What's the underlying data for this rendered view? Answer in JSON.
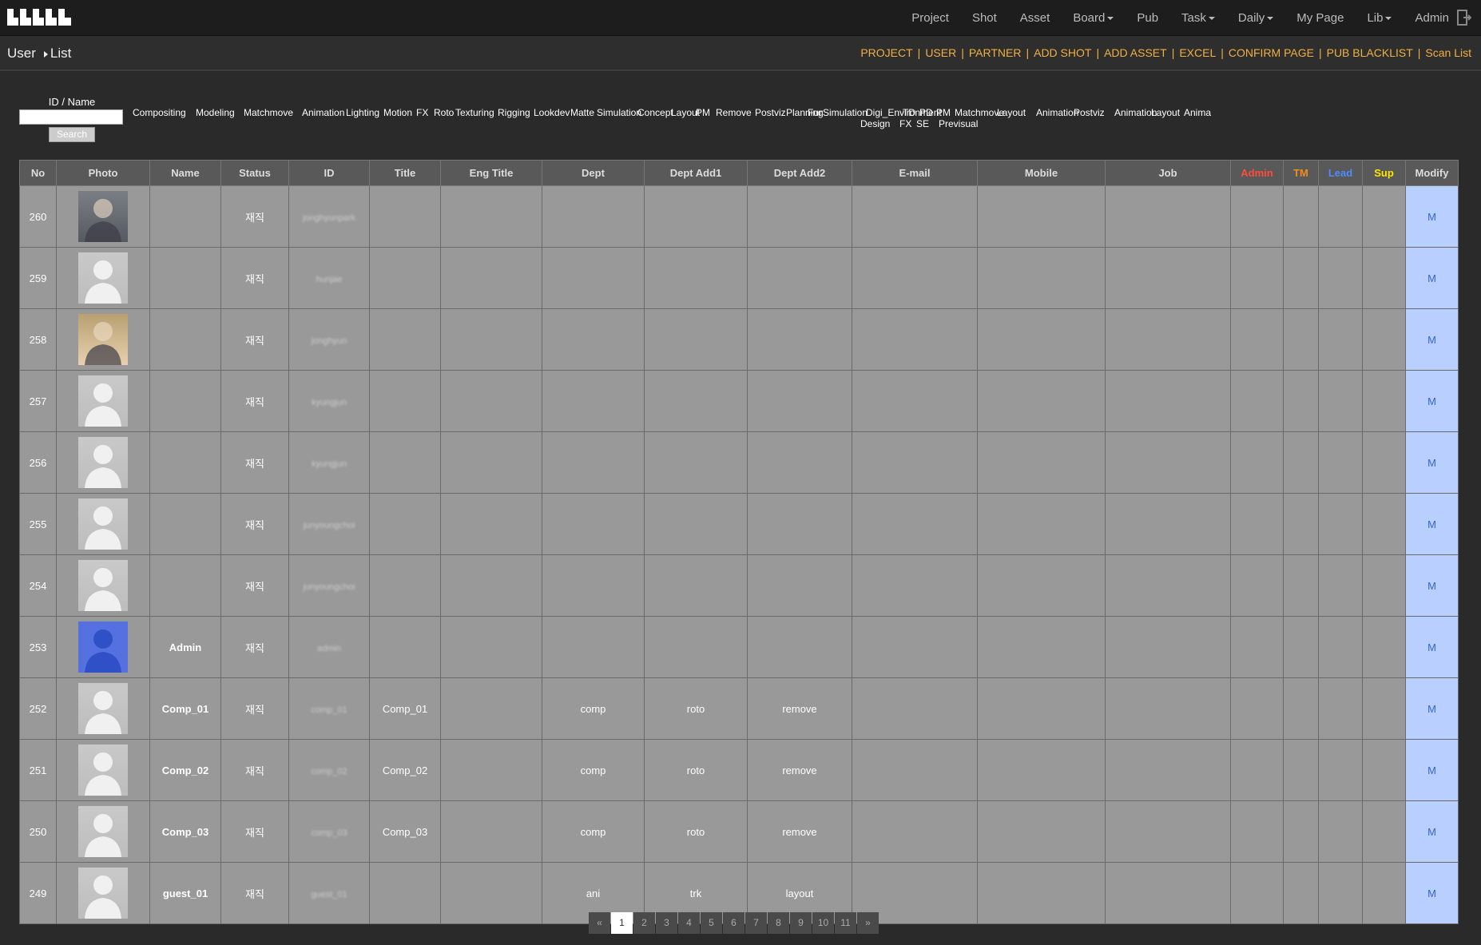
{
  "nav": {
    "logo": "logo",
    "items": [
      {
        "label": "Project",
        "dropdown": false
      },
      {
        "label": "Shot",
        "dropdown": false
      },
      {
        "label": "Asset",
        "dropdown": false
      },
      {
        "label": "Board",
        "dropdown": true
      },
      {
        "label": "Pub",
        "dropdown": false
      },
      {
        "label": "Task",
        "dropdown": true
      },
      {
        "label": "Daily",
        "dropdown": true
      },
      {
        "label": "My Page",
        "dropdown": false
      },
      {
        "label": "Lib",
        "dropdown": true
      },
      {
        "label": "Admin",
        "dropdown": false
      }
    ],
    "exit_icon": "exit-icon"
  },
  "breadcrumb": {
    "root": "User",
    "current": "List"
  },
  "actions": [
    "PROJECT",
    "USER",
    "PARTNER",
    "ADD SHOT",
    "ADD ASSET",
    "EXCEL",
    "CONFIRM PAGE",
    "PUB BLACKLIST",
    "Scan List"
  ],
  "search": {
    "label": "ID / Name",
    "value": "",
    "button": "Search"
  },
  "filters": {
    "row1": [
      "Compositing",
      "Modeling",
      "Matchmove",
      "Animation",
      "Lighting",
      "Motion",
      "FX",
      "Roto",
      "Texturing",
      "Rigging",
      "Lookdev",
      "Matte",
      "Simulation",
      "Concept",
      "Layout",
      "PM",
      "Remove",
      "Postviz",
      "Planning",
      "Fur",
      "Simulation",
      "Digi_Environment",
      "TD",
      "PD",
      "PM",
      "Matchmove",
      "Layout",
      "Animation",
      "Postviz",
      "Animation",
      "Layout",
      "Anima"
    ],
    "row2": [
      "Design",
      "FX",
      "SE",
      "Previsual"
    ]
  },
  "table": {
    "headers": [
      "No",
      "Photo",
      "Name",
      "Status",
      "ID",
      "Title",
      "Eng Title",
      "Dept",
      "Dept Add1",
      "Dept Add2",
      "E-mail",
      "Mobile",
      "Job",
      "Admin",
      "TM",
      "Lead",
      "Sup",
      "Modify"
    ],
    "rows": [
      {
        "no": "260",
        "photo": "p1",
        "name": "",
        "status": "재직",
        "id": "jonghyunpark",
        "title": "",
        "dept": "",
        "add1": "",
        "add2": "",
        "modify": "M"
      },
      {
        "no": "259",
        "photo": "default",
        "name": "",
        "status": "재직",
        "id": "hunjae",
        "title": "",
        "dept": "",
        "add1": "",
        "add2": "",
        "modify": "M"
      },
      {
        "no": "258",
        "photo": "p2",
        "name": "",
        "status": "재직",
        "id": "jonghyun",
        "title": "",
        "dept": "",
        "add1": "",
        "add2": "",
        "modify": "M"
      },
      {
        "no": "257",
        "photo": "default",
        "name": "",
        "status": "재직",
        "id": "kyungjun",
        "title": "",
        "dept": "",
        "add1": "",
        "add2": "",
        "modify": "M"
      },
      {
        "no": "256",
        "photo": "default",
        "name": "",
        "status": "재직",
        "id": "kyungjun",
        "title": "",
        "dept": "",
        "add1": "",
        "add2": "",
        "modify": "M"
      },
      {
        "no": "255",
        "photo": "default",
        "name": "",
        "status": "재직",
        "id": "junyoungchoi",
        "title": "",
        "dept": "",
        "add1": "",
        "add2": "",
        "modify": "M"
      },
      {
        "no": "254",
        "photo": "default",
        "name": "",
        "status": "재직",
        "id": "junyoungchoi",
        "title": "",
        "dept": "",
        "add1": "",
        "add2": "",
        "modify": "M"
      },
      {
        "no": "253",
        "photo": "admin",
        "name": "Admin",
        "status": "재직",
        "id": "admin",
        "title": "",
        "dept": "",
        "add1": "",
        "add2": "",
        "modify": "M"
      },
      {
        "no": "252",
        "photo": "default",
        "name": "Comp_01",
        "status": "재직",
        "id": "comp_01",
        "title": "Comp_01",
        "dept": "comp",
        "add1": "roto",
        "add2": "remove",
        "modify": "M"
      },
      {
        "no": "251",
        "photo": "default",
        "name": "Comp_02",
        "status": "재직",
        "id": "comp_02",
        "title": "Comp_02",
        "dept": "comp",
        "add1": "roto",
        "add2": "remove",
        "modify": "M"
      },
      {
        "no": "250",
        "photo": "default",
        "name": "Comp_03",
        "status": "재직",
        "id": "comp_03",
        "title": "Comp_03",
        "dept": "comp",
        "add1": "roto",
        "add2": "remove",
        "modify": "M"
      },
      {
        "no": "249",
        "photo": "default",
        "name": "guest_01",
        "status": "재직",
        "id": "guest_01",
        "title": "",
        "dept": "ani",
        "add1": "trk",
        "add2": "layout",
        "modify": "M"
      }
    ]
  },
  "pagination": {
    "prev": "«",
    "pages": [
      "1",
      "2",
      "3",
      "4",
      "5",
      "6",
      "7",
      "8",
      "9",
      "10",
      "11"
    ],
    "active": "1",
    "next": "»"
  },
  "colors": {
    "action": "#f0b040",
    "admin": "#ff4c3c",
    "tm": "#f08c1e",
    "lead": "#4c8cff",
    "sup": "#ffe400",
    "modify_bg": "#b9cfff"
  }
}
